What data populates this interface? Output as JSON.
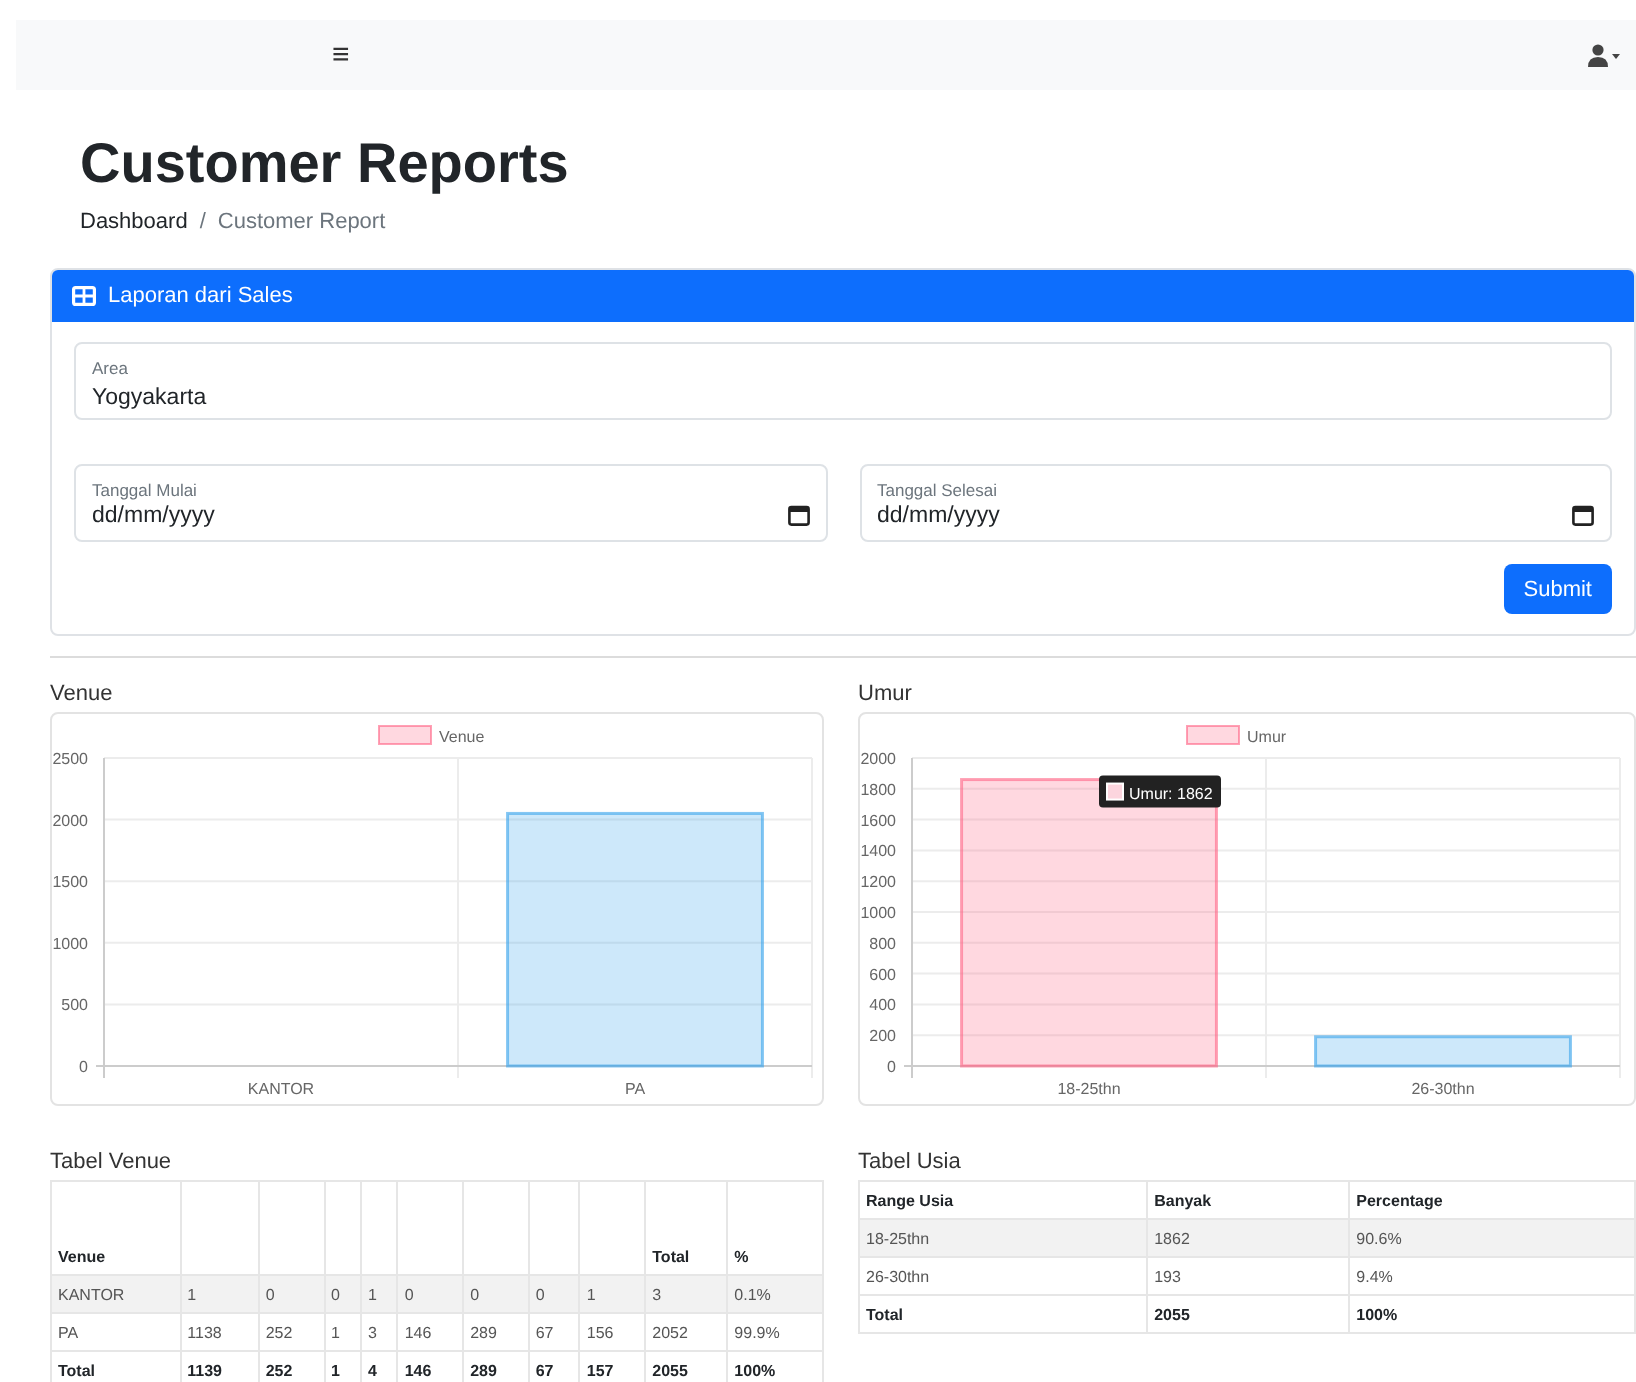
{
  "navbar": {
    "menu_glyph": "≡"
  },
  "page": {
    "title": "Customer Reports",
    "breadcrumb_separator": "/",
    "breadcrumb": [
      {
        "label": "Dashboard",
        "active": false
      },
      {
        "label": "Customer Report",
        "active": true
      }
    ]
  },
  "form_card": {
    "header": "Laporan dari Sales",
    "area": {
      "label": "Area",
      "value": "Yogyakarta"
    },
    "start_date": {
      "label": "Tanggal Mulai",
      "placeholder": "dd/mm/yyyy"
    },
    "end_date": {
      "label": "Tanggal Selesai",
      "placeholder": "dd/mm/yyyy"
    },
    "submit": "Submit"
  },
  "charts": [
    {
      "title": "Venue",
      "chart_data": {
        "type": "bar",
        "grid": true,
        "categories": [
          "KANTOR",
          "PA"
        ],
        "series": [
          {
            "name": "Venue",
            "color": "#ff6384",
            "values": [
              0,
              null
            ]
          },
          {
            "color": "#36a2eb",
            "values": [
              null,
              2050
            ]
          }
        ],
        "ylim": [
          0,
          2500
        ],
        "yticks": [
          0,
          500,
          1000,
          1500,
          2000,
          2500
        ]
      }
    },
    {
      "title": "Umur",
      "chart_data": {
        "type": "bar",
        "grid": true,
        "categories": [
          "18-25thn",
          "26-30thn"
        ],
        "series": [
          {
            "name": "Umur",
            "color": "#ff6384",
            "values": [
              1860,
              null
            ]
          },
          {
            "color": "#36a2eb",
            "values": [
              null,
              190
            ]
          }
        ],
        "ylim": [
          0,
          2000
        ],
        "yticks": [
          0,
          200,
          400,
          600,
          800,
          1000,
          1200,
          1400,
          1600,
          1800,
          2000
        ],
        "annotations": [
          {
            "x": "18-25thn",
            "y": 1860,
            "text": "Umur: 1862"
          }
        ]
      }
    }
  ],
  "venue_table": {
    "title": "Tabel Venue",
    "columns": [
      "Venue",
      null,
      null,
      null,
      null,
      null,
      null,
      null,
      null,
      "Total",
      "%"
    ],
    "rows": [
      {
        "total": false,
        "cells": [
          "KANTOR",
          "1",
          "0",
          "0",
          "1",
          "0",
          "0",
          "0",
          "1",
          "3",
          "0.1%"
        ]
      },
      {
        "total": false,
        "cells": [
          "PA",
          "1138",
          "252",
          "1",
          "3",
          "146",
          "289",
          "67",
          "156",
          "2052",
          "99.9%"
        ]
      },
      {
        "total": true,
        "cells": [
          "Total",
          "1139",
          "252",
          "1",
          "4",
          "146",
          "289",
          "67",
          "157",
          "2055",
          "100%"
        ]
      }
    ]
  },
  "age_table": {
    "title": "Tabel Usia",
    "columns": [
      "Range Usia",
      "Banyak",
      "Percentage"
    ],
    "rows": [
      {
        "total": false,
        "cells": [
          "18-25thn",
          "1862",
          "90.6%"
        ]
      },
      {
        "total": false,
        "cells": [
          "26-30thn",
          "193",
          "9.4%"
        ]
      },
      {
        "total": true,
        "cells": [
          "Total",
          "2055",
          "100%"
        ]
      }
    ]
  }
}
